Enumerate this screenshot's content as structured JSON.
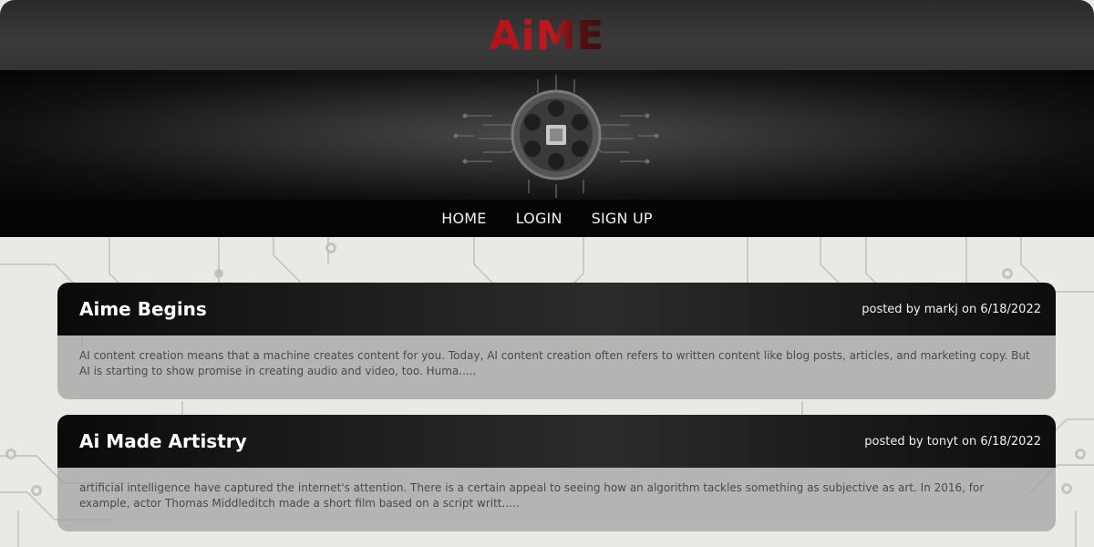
{
  "site": {
    "logo": "AiME"
  },
  "nav": {
    "items": [
      {
        "label": "HOME"
      },
      {
        "label": "LOGIN"
      },
      {
        "label": "SIGN UP"
      }
    ]
  },
  "posts": [
    {
      "title": "Aime Begins",
      "meta": "posted by markj on 6/18/2022",
      "excerpt": "AI content creation means that a machine creates content for you. Today, AI content creation often refers to written content like blog posts, articles, and marketing copy. But AI is starting to show promise in creating audio and video, too. Huma....."
    },
    {
      "title": "Ai Made Artistry",
      "meta": "posted by tonyt on 6/18/2022",
      "excerpt": "artificial intelligence have captured the internet's attention. There is a certain appeal to seeing how an algorithm tackles something as subjective as art. In 2016, for example, actor Thomas Middleditch made a short film based on a script writt....."
    }
  ],
  "colors": {
    "brand": "#b3121a",
    "nav_bg": "#050505",
    "page_bg": "#e9e9e6"
  },
  "icons": {
    "banner": "film-reel-chip-icon"
  }
}
